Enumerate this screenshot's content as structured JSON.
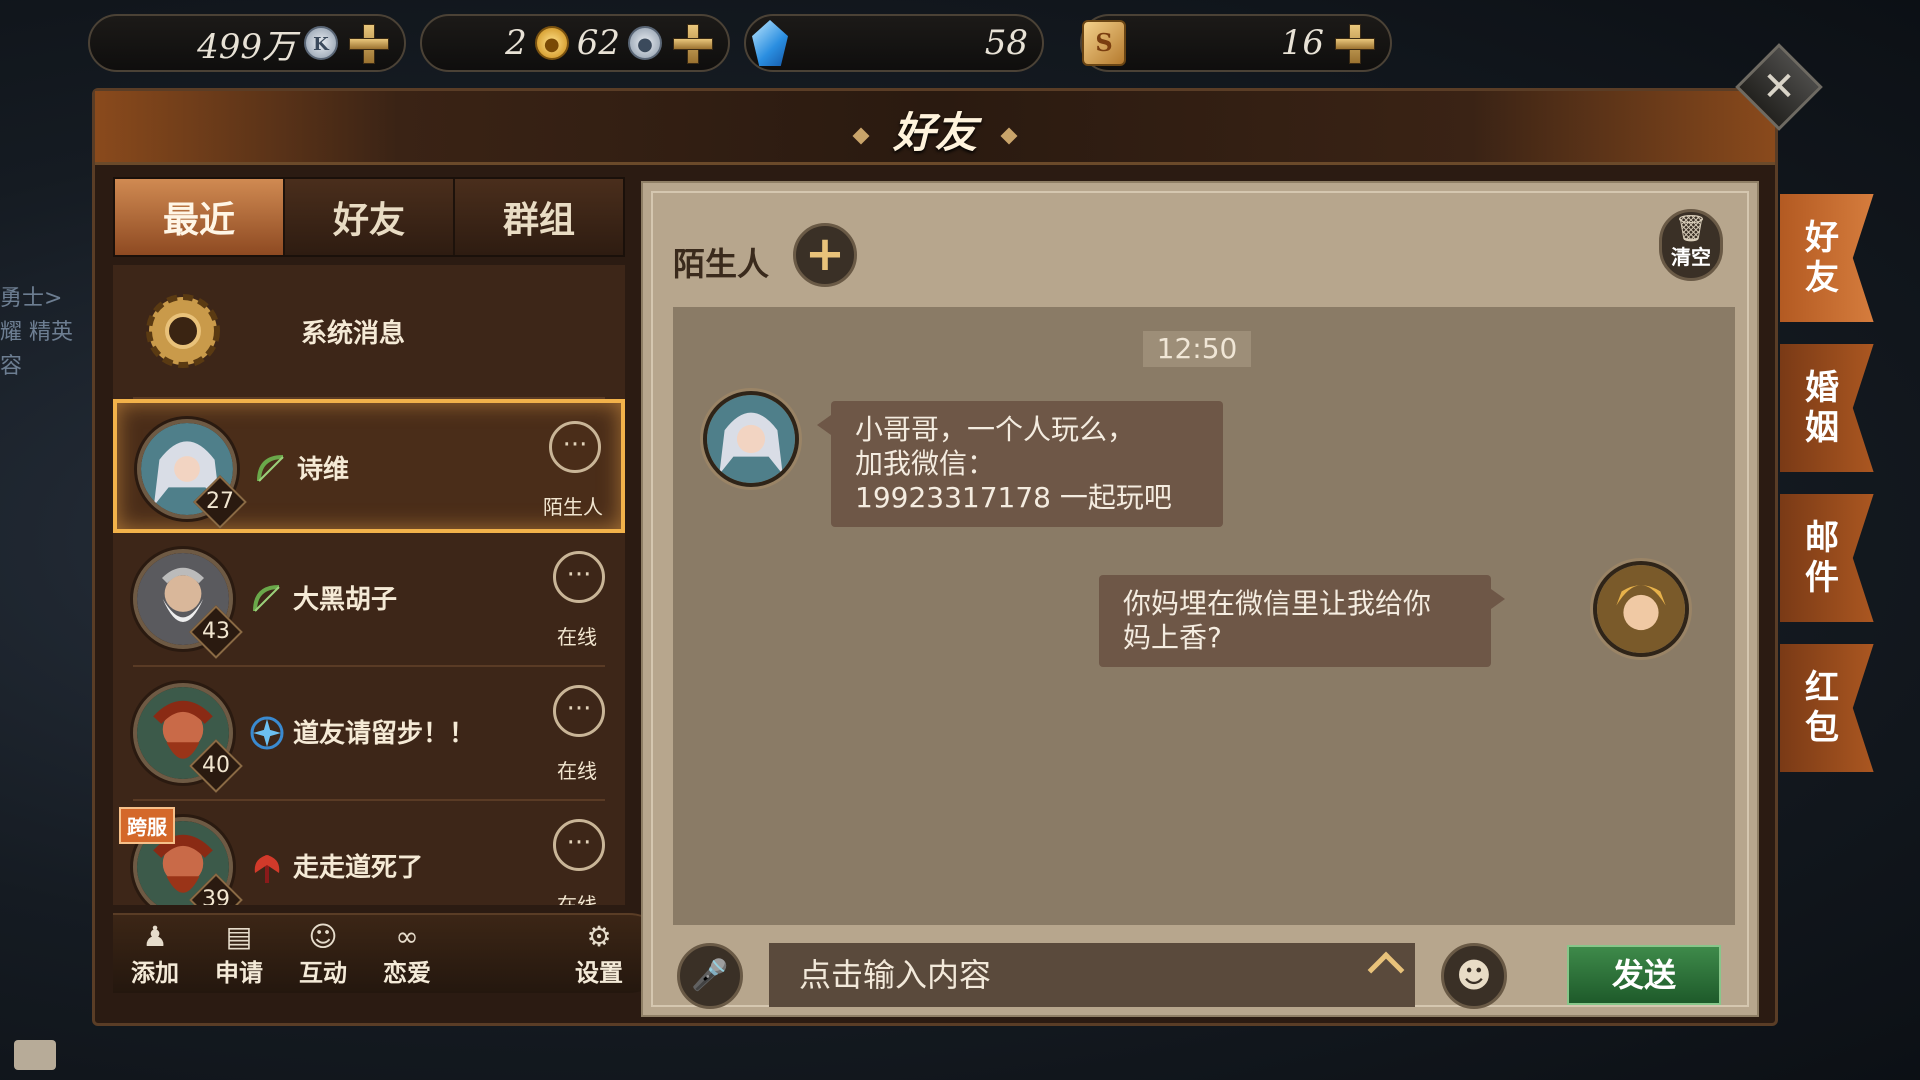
{
  "currency": {
    "coins_value": "499万",
    "coin_icon_letter": "K",
    "gold_value": "2",
    "silver_value": "62",
    "gems_value": "58",
    "tickets_value": "16"
  },
  "panel": {
    "title": "好友"
  },
  "tabs": [
    {
      "label": "最近",
      "active": true
    },
    {
      "label": "好友",
      "active": false
    },
    {
      "label": "群组",
      "active": false
    }
  ],
  "system_row": {
    "label": "系统消息"
  },
  "contacts": [
    {
      "name": "诗维",
      "level": "27",
      "status": "陌生人",
      "selected": true,
      "cross_server": "",
      "class_icon": "bow-icon"
    },
    {
      "name": "大黑胡子",
      "level": "43",
      "status": "在线",
      "selected": false,
      "cross_server": "",
      "class_icon": "bow-icon"
    },
    {
      "name": "道友请留步！！",
      "level": "40",
      "status": "在线",
      "selected": false,
      "cross_server": "",
      "class_icon": "mage-star-icon"
    },
    {
      "name": "走走道死了",
      "level": "39",
      "status": "在线",
      "selected": false,
      "cross_server": "跨服",
      "class_icon": "axe-icon"
    }
  ],
  "bottom_bar": {
    "add": "添加",
    "apply": "申请",
    "interact": "互动",
    "love": "恋爱",
    "settings": "设置"
  },
  "chat": {
    "stranger_label": "陌生人",
    "clear_label": "清空",
    "time": "12:50",
    "incoming_lines": [
      "小哥哥，一个人玩么，",
      "加我微信：",
      "19923317178 一起玩吧"
    ],
    "outgoing_lines": [
      "你妈埋在微信里让我给你",
      "妈上香?"
    ],
    "input_placeholder": "点击输入内容",
    "send_label": "发送"
  },
  "side_tabs": [
    {
      "label": "好友",
      "active": true
    },
    {
      "label": "婚姻",
      "active": false
    },
    {
      "label": "邮件",
      "active": false
    },
    {
      "label": "红包",
      "active": false
    }
  ],
  "left_peek": [
    "勇士>",
    "耀 精英",
    "容"
  ],
  "colors": {
    "accent_gold": "#f2b24a",
    "send_green": "#2e7a3a",
    "tab_active": "#c07a42",
    "side_tab_orange": "#b05a22"
  }
}
